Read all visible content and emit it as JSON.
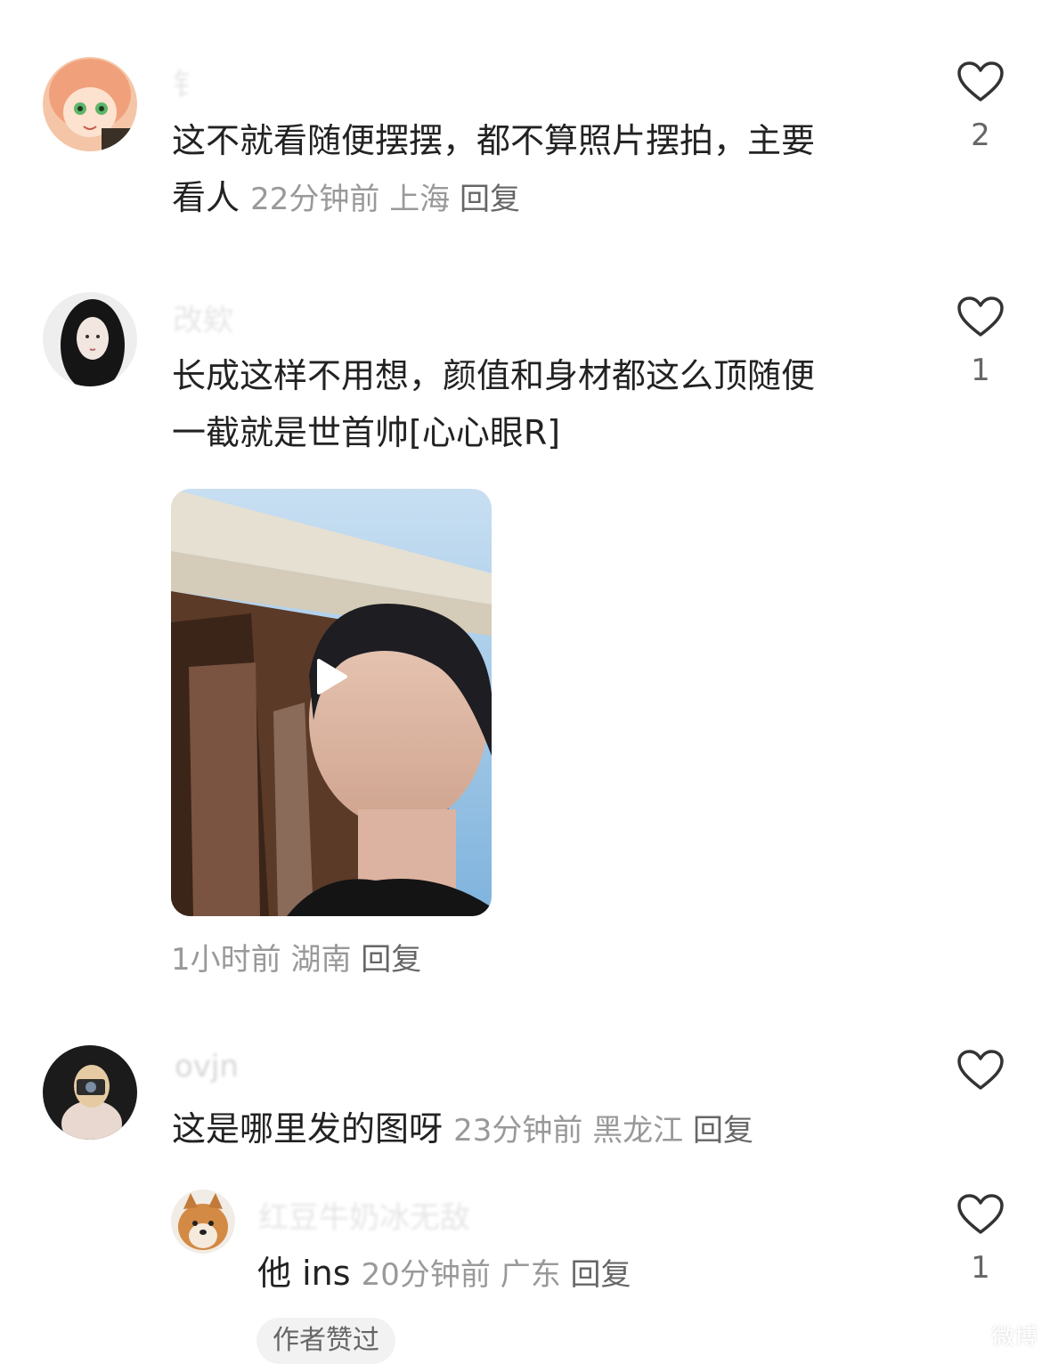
{
  "colors": {
    "text": "#222222",
    "meta": "#999999",
    "reply": "#666666",
    "heart": "#333333",
    "username_faded": "#e6e6e6",
    "badge_bg": "#f2f2f2"
  },
  "comments": [
    {
      "username": "钅",
      "text_line1": "这不就看随便摆摆，都不算照片摆拍，主要",
      "text_line2": "看人",
      "time": "22分钟前",
      "location": "上海",
      "reply_label": "回复",
      "like_icon": "heart-outline-icon",
      "likes": "2"
    },
    {
      "username": "改欸",
      "text_line1": "长成这样不用想，颜值和身材都这么顶随便",
      "text_line2": "一截就是世首帅[心心眼R]",
      "has_video": true,
      "media_icon": "play-icon",
      "time": "1小时前",
      "location": "湖南",
      "reply_label": "回复",
      "like_icon": "heart-outline-icon",
      "likes": "1"
    },
    {
      "username": "ovjn",
      "text": "这是哪里发的图呀",
      "time": "23分钟前",
      "location": "黑龙江",
      "reply_label": "回复",
      "like_icon": "heart-outline-icon",
      "likes": "",
      "replies": [
        {
          "username": "红豆牛奶冰无敌",
          "text": "他 ins",
          "time": "20分钟前",
          "location": "广东",
          "reply_label": "回复",
          "like_icon": "heart-outline-icon",
          "likes": "1",
          "badge": "作者赞过"
        }
      ]
    }
  ],
  "watermark": "微博"
}
